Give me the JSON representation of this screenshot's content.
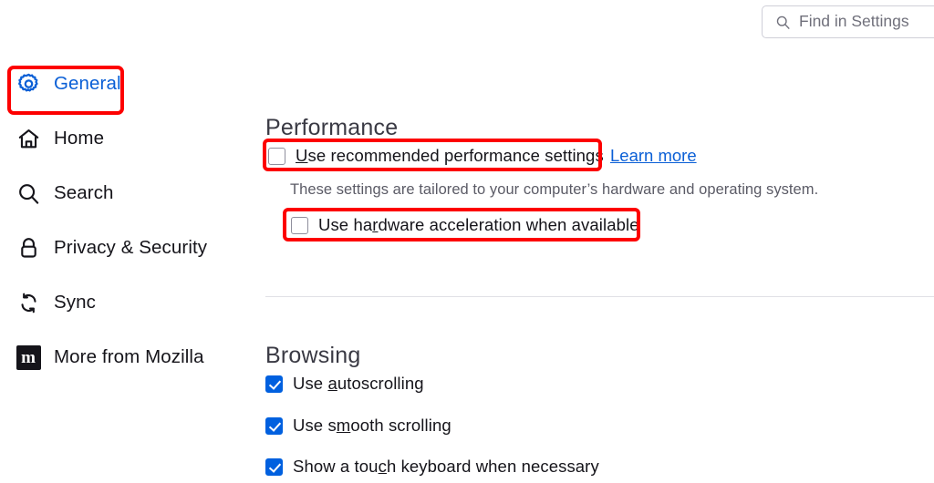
{
  "search": {
    "placeholder": "Find in Settings",
    "icon": "search-icon"
  },
  "sidebar": {
    "items": [
      {
        "label": "General",
        "icon": "gear-icon",
        "selected": true
      },
      {
        "label": "Home",
        "icon": "home-icon",
        "selected": false
      },
      {
        "label": "Search",
        "icon": "search-icon",
        "selected": false
      },
      {
        "label": "Privacy & Security",
        "icon": "lock-icon",
        "selected": false
      },
      {
        "label": "Sync",
        "icon": "sync-icon",
        "selected": false
      },
      {
        "label": "More from Mozilla",
        "icon": "mozilla-m-icon",
        "selected": false
      }
    ],
    "mozilla_glyph": "m"
  },
  "main": {
    "performance": {
      "heading": "Performance",
      "recommended": {
        "label_before": "",
        "accesskey": "U",
        "label_after": "se recommended performance settings",
        "checked": false
      },
      "learn_more": "Learn more",
      "description": "These settings are tailored to your computer’s hardware and operating system.",
      "hardware": {
        "label_before": "Use ha",
        "accesskey": "r",
        "label_after": "dware acceleration when available",
        "checked": false
      }
    },
    "browsing": {
      "heading": "Browsing",
      "options": [
        {
          "label_before": "Use ",
          "accesskey": "a",
          "label_after": "utoscrolling",
          "checked": true
        },
        {
          "label_before": "Use s",
          "accesskey": "m",
          "label_after": "ooth scrolling",
          "checked": true
        },
        {
          "label_before": "Show a tou",
          "accesskey": "c",
          "label_after": "h keyboard when necessary",
          "checked": true
        }
      ]
    }
  },
  "colors": {
    "accent_blue": "#0060df",
    "link_blue": "#0a5fd6",
    "highlight_red": "#fd0000",
    "text": "#15141a",
    "muted_text": "#5b5b66",
    "divider": "#e0e0e6"
  }
}
